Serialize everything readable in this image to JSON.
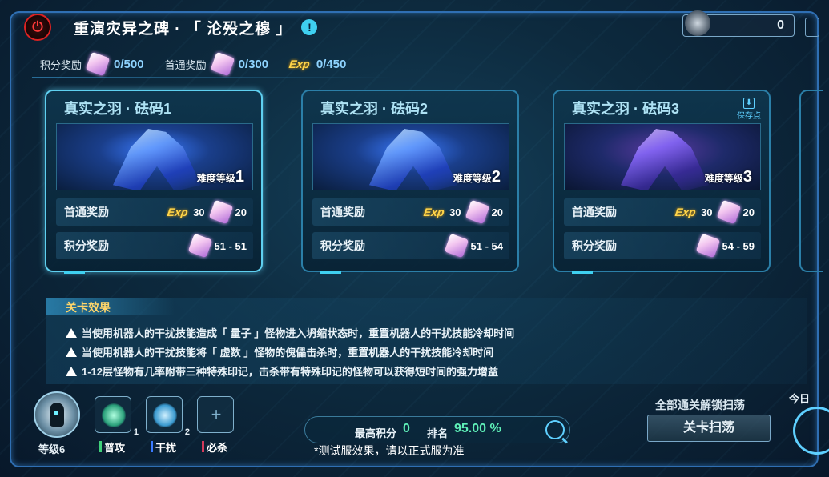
{
  "header": {
    "title": "重演灾异之碑 · 「 沦殁之穆 」",
    "coin_value": "0"
  },
  "rewards": {
    "points_label": "积分奖励",
    "points_value": "0/500",
    "first_label": "首通奖励",
    "first_value": "0/300",
    "exp_icon_text": "Exp",
    "exp_value": "0/450"
  },
  "cards": [
    {
      "title": "真实之羽 · 砝码1",
      "difficulty_label": "难度等级",
      "difficulty": "1",
      "first_label": "首通奖励",
      "first_exp": "30",
      "first_gem": "20",
      "points_label": "积分奖励",
      "points_range": "51 - 51"
    },
    {
      "title": "真实之羽 · 砝码2",
      "difficulty_label": "难度等级",
      "difficulty": "2",
      "first_label": "首通奖励",
      "first_exp": "30",
      "first_gem": "20",
      "points_label": "积分奖励",
      "points_range": "51 - 54"
    },
    {
      "title": "真实之羽 · 砝码3",
      "difficulty_label": "难度等级",
      "difficulty": "3",
      "first_label": "首通奖励",
      "first_exp": "30",
      "first_gem": "20",
      "points_label": "积分奖励",
      "points_range": "54 - 59",
      "save_label": "保存点"
    }
  ],
  "effects": {
    "header": "关卡效果",
    "lines": [
      "当使用机器人的干扰技能造成「 量子 」怪物进入坍缩状态时，重置机器人的干扰技能冷却时间",
      "当使用机器人的干扰技能将「 虚数 」怪物的傀儡击杀时，重置机器人的干扰技能冷却时间",
      "1-12层怪物有几率附带三种特殊印记，击杀带有特殊印记的怪物可以获得短时间的强力增益"
    ]
  },
  "robot": {
    "level": "等级6"
  },
  "skills": [
    {
      "label": "普攻",
      "count": "1",
      "color": "#3fd07a"
    },
    {
      "label": "干扰",
      "count": "2",
      "color": "#3a7aff"
    },
    {
      "label": "必杀",
      "count": "",
      "color": "#d23a5a"
    }
  ],
  "score": {
    "best_label": "最高积分",
    "best_value": "0",
    "rank_label": "排名",
    "rank_value": "95.00 %"
  },
  "note": "*测试服效果，请以正式服为准",
  "sweep": {
    "unlock_text": "全部通关解锁扫荡",
    "button_label": "关卡扫荡"
  },
  "today_label": "今日"
}
